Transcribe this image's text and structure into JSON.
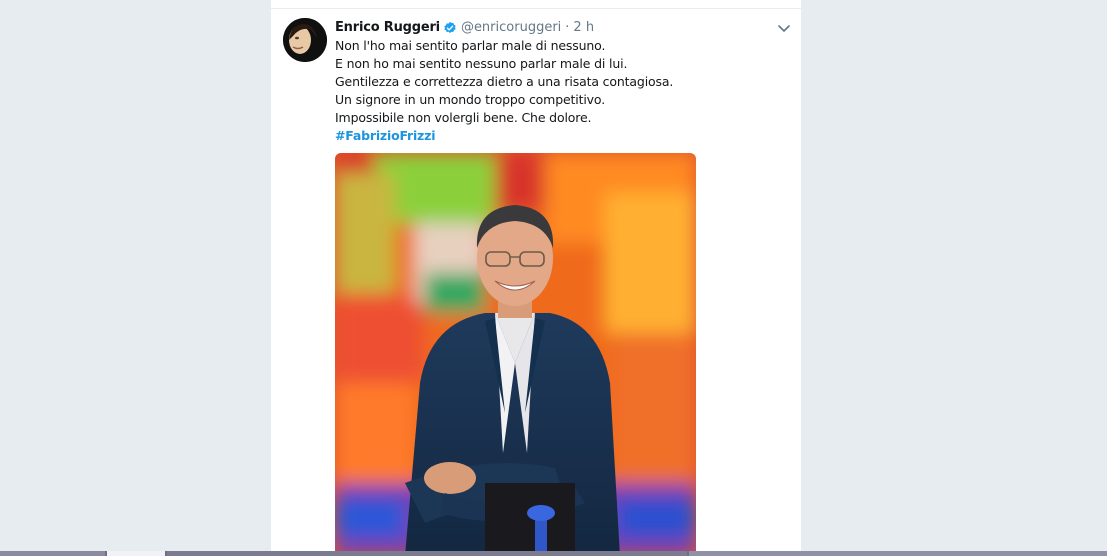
{
  "tweet": {
    "author_name": "Enrico Ruggeri",
    "verified": true,
    "handle": "@enricoruggeri",
    "separator": "·",
    "time": "2 h",
    "lines": [
      "Non l'ho mai sentito parlar male di nessuno.",
      "E non ho mai sentito nessuno parlar male di lui.",
      "Gentilezza e correttezza dietro a una risata contagiosa.",
      "Un signore in un mondo troppo competitivo.",
      "Impossibile non volergli bene. Che dolore."
    ],
    "hashtag": "#FabrizioFrizzi"
  },
  "icons": {
    "verified": "verified-badge-icon",
    "menu": "chevron-down-icon"
  },
  "colors": {
    "link": "#1b95e0",
    "verified": "#1da1f2",
    "page_background": "#e6ecf0",
    "muted_text": "#657786"
  }
}
